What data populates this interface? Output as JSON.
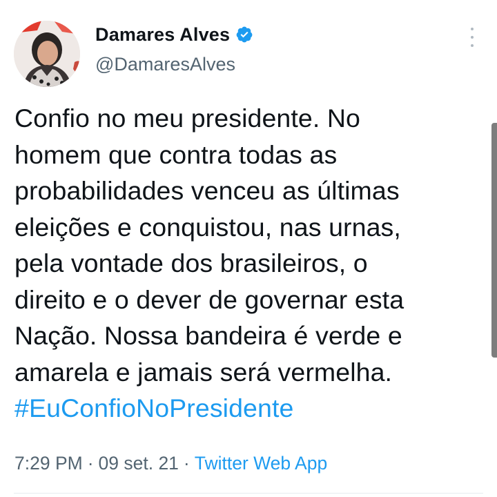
{
  "tweet": {
    "author": {
      "display_name": "Damares Alves",
      "handle": "@DamaresAlves",
      "verified": true,
      "verified_icon": "verified-badge-icon",
      "avatar_icon": "avatar-photo"
    },
    "text_lines": [
      "Confio no meu presidente. No",
      "homem que contra todas as",
      "probabilidades venceu as últimas",
      "eleições e conquistou, nas urnas,",
      "pela vontade dos brasileiros, o",
      "direito e o dever de governar esta",
      "Nação. Nossa bandeira é verde e",
      "amarela e jamais será vermelha."
    ],
    "hashtag": "#EuConfioNoPresidente",
    "time": "7:29 PM",
    "date": "09 set. 21",
    "separator": "·",
    "source": "Twitter Web App",
    "more_icon": "more-options-icon"
  },
  "colors": {
    "text": "#0f1419",
    "secondary": "#536471",
    "link": "#1d9bf0",
    "verified": "#1d9bf0"
  }
}
